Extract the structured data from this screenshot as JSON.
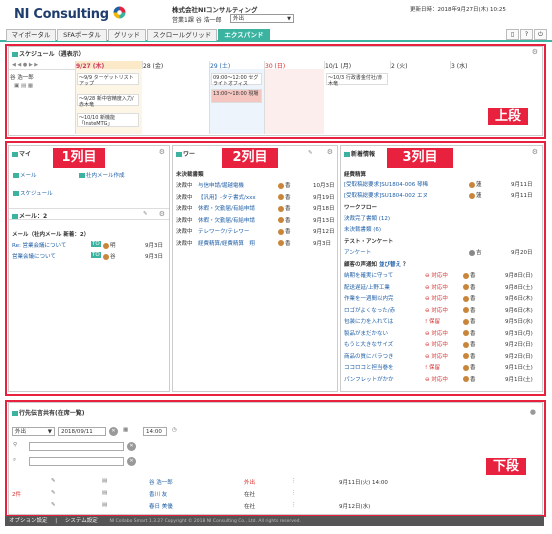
{
  "header": {
    "logo": "NI Consulting",
    "company": "株式会社NIコンサルティング",
    "dept": "営業1課",
    "user": "谷 浩一郎",
    "status_select": "外出",
    "updated": "更新日時：2018年9月27日(木) 10:25"
  },
  "tabs": [
    "マイポータル",
    "SFAポータル",
    "グリッド",
    "スクロールグリッド",
    "エクスパンド"
  ],
  "tab_icons": [
    "book-icon",
    "help-icon",
    "power-icon"
  ],
  "labels": {
    "top": "上段",
    "col1": "1列目",
    "col2": "2列目",
    "col3": "3列目",
    "bottom": "下段"
  },
  "schedule": {
    "title": "スケジュール（週表示）",
    "person": "谷 浩一郎",
    "days": [
      "9/27 (木)",
      "28 (金)",
      "29 (土)",
      "30 (日)",
      "10/1 (月)",
      "2 (火)",
      "3 (水)"
    ],
    "events": {
      "d0": [
        "～9/9 ターゲットリストアップ",
        "～9/28 新中容精度入力/赤木竜",
        "～10/10 新機能「InsteMTG」"
      ],
      "d2a": "09:00～12:00 セグライトオフィス",
      "d2b": "13:00～18:00 現場",
      "d4": "～10/3 行政書金付社/赤木竜"
    }
  },
  "my": {
    "title": "マイ",
    "mail": "メール",
    "company_mail": "社内メール作成",
    "schedule": "スケジュール",
    "mail_title": "メール：2",
    "mail_sub": "メール（社内メール 新着：2）",
    "mails": [
      {
        "subject": "Re: 営業会議について",
        "tag": "TO",
        "from": "明",
        "date": "9月3日"
      },
      {
        "subject": "営業会議について",
        "tag": "TO",
        "from": "谷",
        "date": "9月3日"
      }
    ]
  },
  "wf": {
    "title": "ワー",
    "sub": "未決裁書類",
    "rows": [
      {
        "status": "決裁中",
        "text": "与信申請/堀越電機",
        "who": "香",
        "date": "10月3日"
      },
      {
        "status": "決裁中",
        "text": "【汎用】-タテ書式/xxx",
        "who": "香",
        "date": "9月19日"
      },
      {
        "status": "決裁中",
        "text": "休暇・欠勤届/有給申請",
        "who": "香",
        "date": "9月18日"
      },
      {
        "status": "決裁中",
        "text": "休暇・欠勤届/有給申請",
        "who": "香",
        "date": "9月13日"
      },
      {
        "status": "決裁中",
        "text": "テレワーク/テレワー",
        "who": "香",
        "date": "9月12日"
      },
      {
        "status": "決裁中",
        "text": "経費精算/経費精算　翔",
        "who": "香",
        "date": "9月3日"
      }
    ]
  },
  "news": {
    "title": "新着情報",
    "expense": "経費精算",
    "expense_rows": [
      {
        "text": "[受取稿総要求]SU1804-006 琴稀",
        "who": "蓮",
        "date": "9月11日"
      },
      {
        "text": "[受取稿総要求]SU1804-002 エヌ",
        "who": "蓮",
        "date": "9月11日"
      }
    ],
    "workflow": "ワークフロー",
    "wf_rows": [
      "決裁完了書類 (12)",
      "未決裁書類 (6)"
    ],
    "test": "テスト・アンケート",
    "test_row": {
      "text": "アンケート",
      "who": "吉",
      "date": "9月20日"
    },
    "customer": "顧客の声通知",
    "customer_link": "並び替え",
    "customer_q": "？",
    "voices": [
      {
        "text": "納期を確実に守って",
        "st": "対応中",
        "who": "香",
        "date": "9月8日(日)"
      },
      {
        "text": "配送遅延/上野工業",
        "st": "対応中",
        "who": "香",
        "date": "9月8日(土)"
      },
      {
        "text": "作業を一週間以内完",
        "st": "対応中",
        "who": "香",
        "date": "9月6日(木)"
      },
      {
        "text": "ロゴがよくなった/赤",
        "st": "対応中",
        "who": "香",
        "date": "9月6日(木)"
      },
      {
        "text": "包装に力を入れては",
        "st": "保留",
        "who": "香",
        "date": "9月5日(水)"
      },
      {
        "text": "製品がまだかない",
        "st": "対応中",
        "who": "香",
        "date": "9月3日(月)"
      },
      {
        "text": "もうと大きなサイズ",
        "st": "対応中",
        "who": "香",
        "date": "9月2日(日)"
      },
      {
        "text": "商品の質にバラつき",
        "st": "対応中",
        "who": "香",
        "date": "9月2日(日)"
      },
      {
        "text": "ココロコと担当巻を",
        "st": "保留",
        "who": "香",
        "date": "9月1日(土)"
      },
      {
        "text": "パンフレットがかか",
        "st": "対応中",
        "who": "香",
        "date": "9月1日(土)"
      }
    ]
  },
  "bottom": {
    "title": "行先伝言共有(在席一覧)",
    "status_val": "外出",
    "date_val": "2018/09/11",
    "time_val": "14:00",
    "count": "2件",
    "rows": [
      {
        "name": "谷 浩一郎",
        "status": "外出",
        "when": "9月11日(火) 14:00"
      },
      {
        "name": "香川 友",
        "status": "在社",
        "when": ""
      },
      {
        "name": "春日 美優",
        "status": "在社",
        "when": "9月12日(水)"
      }
    ]
  },
  "footer": {
    "opt": "オプション設定",
    "sys": "システム設定",
    "copy": "NI Collabo Smart 1.3.27 Copyright © 2018 NI Consulting Co., Ltd. All rights reserved."
  }
}
